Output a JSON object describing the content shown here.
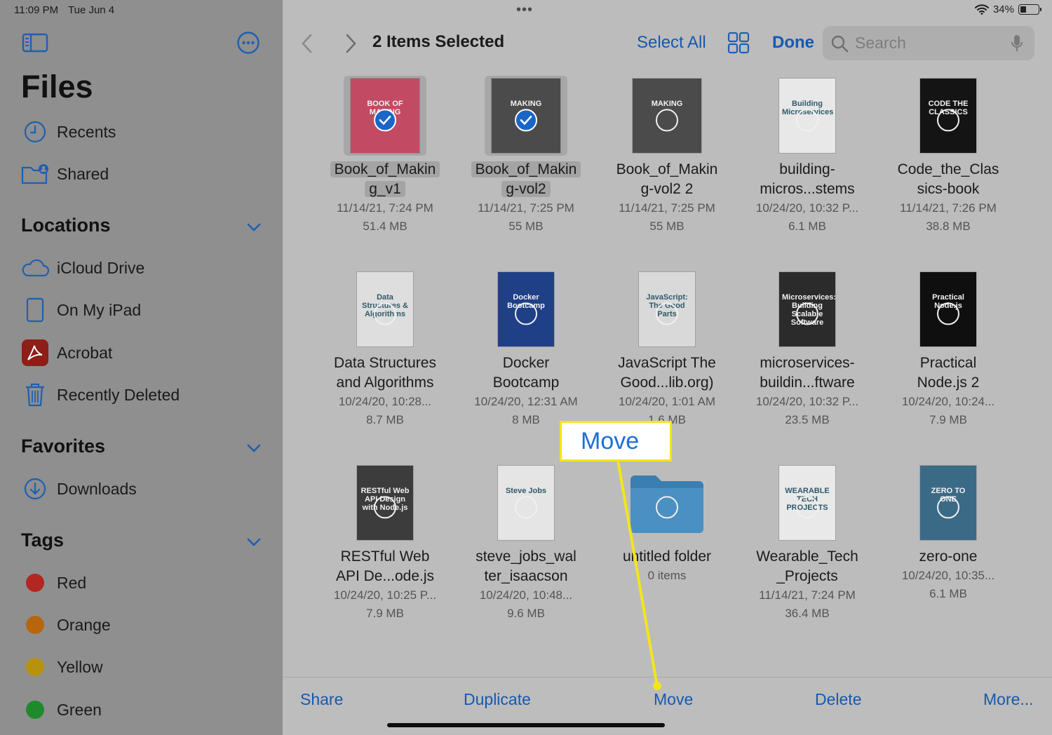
{
  "status": {
    "time": "11:09 PM",
    "date": "Tue Jun 4",
    "battery": "34%",
    "battery_level": 0.34
  },
  "sidebar": {
    "title": "Files",
    "top_items": [
      {
        "label": "Recents",
        "icon": "clock-icon"
      },
      {
        "label": "Shared",
        "icon": "shared-folder-icon"
      }
    ],
    "locations": {
      "title": "Locations",
      "items": [
        {
          "label": "iCloud Drive",
          "icon": "cloud-icon"
        },
        {
          "label": "On My iPad",
          "icon": "ipad-icon"
        },
        {
          "label": "Acrobat",
          "icon": "acrobat-icon"
        },
        {
          "label": "Recently Deleted",
          "icon": "trash-icon"
        }
      ]
    },
    "favorites": {
      "title": "Favorites",
      "items": [
        {
          "label": "Downloads",
          "icon": "download-icon"
        }
      ]
    },
    "tags": {
      "title": "Tags",
      "items": [
        {
          "label": "Red",
          "color": "#b32621"
        },
        {
          "label": "Orange",
          "color": "#b8660e"
        },
        {
          "label": "Yellow",
          "color": "#b8920e"
        },
        {
          "label": "Green",
          "color": "#1f8a2b"
        }
      ]
    }
  },
  "header": {
    "title": "2 Items Selected",
    "select_all": "Select All",
    "done": "Done",
    "search_placeholder": "Search"
  },
  "files": [
    {
      "name1": "Book_of_Makin",
      "name2": "g_v1",
      "date": "11/14/21, 7:24 PM",
      "size": "51.4 MB",
      "selected": true,
      "cover": "#c24a63",
      "cover_text": "BOOK OF MAKING",
      "icon": "book-cover-icon"
    },
    {
      "name1": "Book_of_Makin",
      "name2": "g-vol2",
      "date": "11/14/21, 7:25 PM",
      "size": "55 MB",
      "selected": true,
      "cover": "#4b4b4b",
      "cover_text": "MAKING",
      "icon": "book-cover-icon"
    },
    {
      "name1": "Book_of_Makin",
      "name2": "g-vol2 2",
      "date": "11/14/21, 7:25 PM",
      "size": "55 MB",
      "selected": false,
      "cover": "#4b4b4b",
      "cover_text": "MAKING",
      "icon": "book-cover-icon"
    },
    {
      "name1": "building-",
      "name2": "micros...stems",
      "date": "10/24/20, 10:32 P...",
      "size": "6.1 MB",
      "selected": false,
      "cover": "#e8e8e8",
      "cover_text": "Building Microservices",
      "icon": "book-cover-icon"
    },
    {
      "name1": "Code_the_Clas",
      "name2": "sics-book",
      "date": "11/14/21, 7:26 PM",
      "size": "38.8 MB",
      "selected": false,
      "cover": "#141414",
      "cover_text": "CODE THE CLASSICS",
      "icon": "book-cover-icon"
    },
    {
      "name1": "Data Structures",
      "name2": "and Algorithms",
      "date": "10/24/20, 10:28...",
      "size": "8.7 MB",
      "selected": false,
      "cover": "#dedede",
      "cover_text": "Data Structures & Algorithms",
      "icon": "book-cover-icon"
    },
    {
      "name1": "Docker",
      "name2": "Bootcamp",
      "date": "10/24/20, 12:31 AM",
      "size": "8 MB",
      "selected": false,
      "cover": "#1f3f86",
      "cover_text": "Docker Bootcamp",
      "icon": "book-cover-icon"
    },
    {
      "name1": "JavaScript The",
      "name2": "Good...lib.org)",
      "date": "10/24/20, 1:01 AM",
      "size": "1.6 MB",
      "selected": false,
      "cover": "#d9d9d9",
      "cover_text": "JavaScript: The Good Parts",
      "icon": "book-cover-icon"
    },
    {
      "name1": "microservices-",
      "name2": "buildin...ftware",
      "date": "10/24/20, 10:32 P...",
      "size": "23.5 MB",
      "selected": false,
      "cover": "#2b2b2b",
      "cover_text": "Microservices: Building Scalable Software",
      "icon": "book-cover-icon"
    },
    {
      "name1": "Practical",
      "name2": "Node.js 2",
      "date": "10/24/20, 10:24...",
      "size": "7.9 MB",
      "selected": false,
      "cover": "#0f0f0f",
      "cover_text": "Practical Node.js",
      "icon": "book-cover-icon"
    },
    {
      "name1": "RESTful Web",
      "name2": "API De...ode.js",
      "date": "10/24/20, 10:25 P...",
      "size": "7.9 MB",
      "selected": false,
      "cover": "#3c3c3c",
      "cover_text": "RESTful Web API Design with Node.js",
      "icon": "book-cover-icon"
    },
    {
      "name1": "steve_jobs_wal",
      "name2": "ter_isaacson",
      "date": "10/24/20, 10:48...",
      "size": "9.6 MB",
      "selected": false,
      "cover": "#e5e5e5",
      "cover_text": "Steve Jobs",
      "icon": "book-cover-icon"
    },
    {
      "name1": "untitled folder",
      "name2": "",
      "date": "0 items",
      "size": "",
      "selected": false,
      "cover": "folder",
      "cover_text": "",
      "icon": "folder-icon"
    },
    {
      "name1": "Wearable_Tech",
      "name2": "_Projects",
      "date": "11/14/21, 7:24 PM",
      "size": "36.4 MB",
      "selected": false,
      "cover": "#e9e9e9",
      "cover_text": "WEARABLE TECH PROJECTS",
      "icon": "book-cover-icon"
    },
    {
      "name1": "zero-one",
      "name2": "",
      "date": "10/24/20, 10:35...",
      "size": "6.1 MB",
      "selected": false,
      "cover": "#3b6a86",
      "cover_text": "ZERO TO ONE",
      "icon": "book-cover-icon"
    }
  ],
  "toolbar": {
    "share": "Share",
    "duplicate": "Duplicate",
    "move": "Move",
    "delete": "Delete",
    "more": "More..."
  },
  "annotation": {
    "label": "Move",
    "highlight_color": "#f2e51c"
  }
}
